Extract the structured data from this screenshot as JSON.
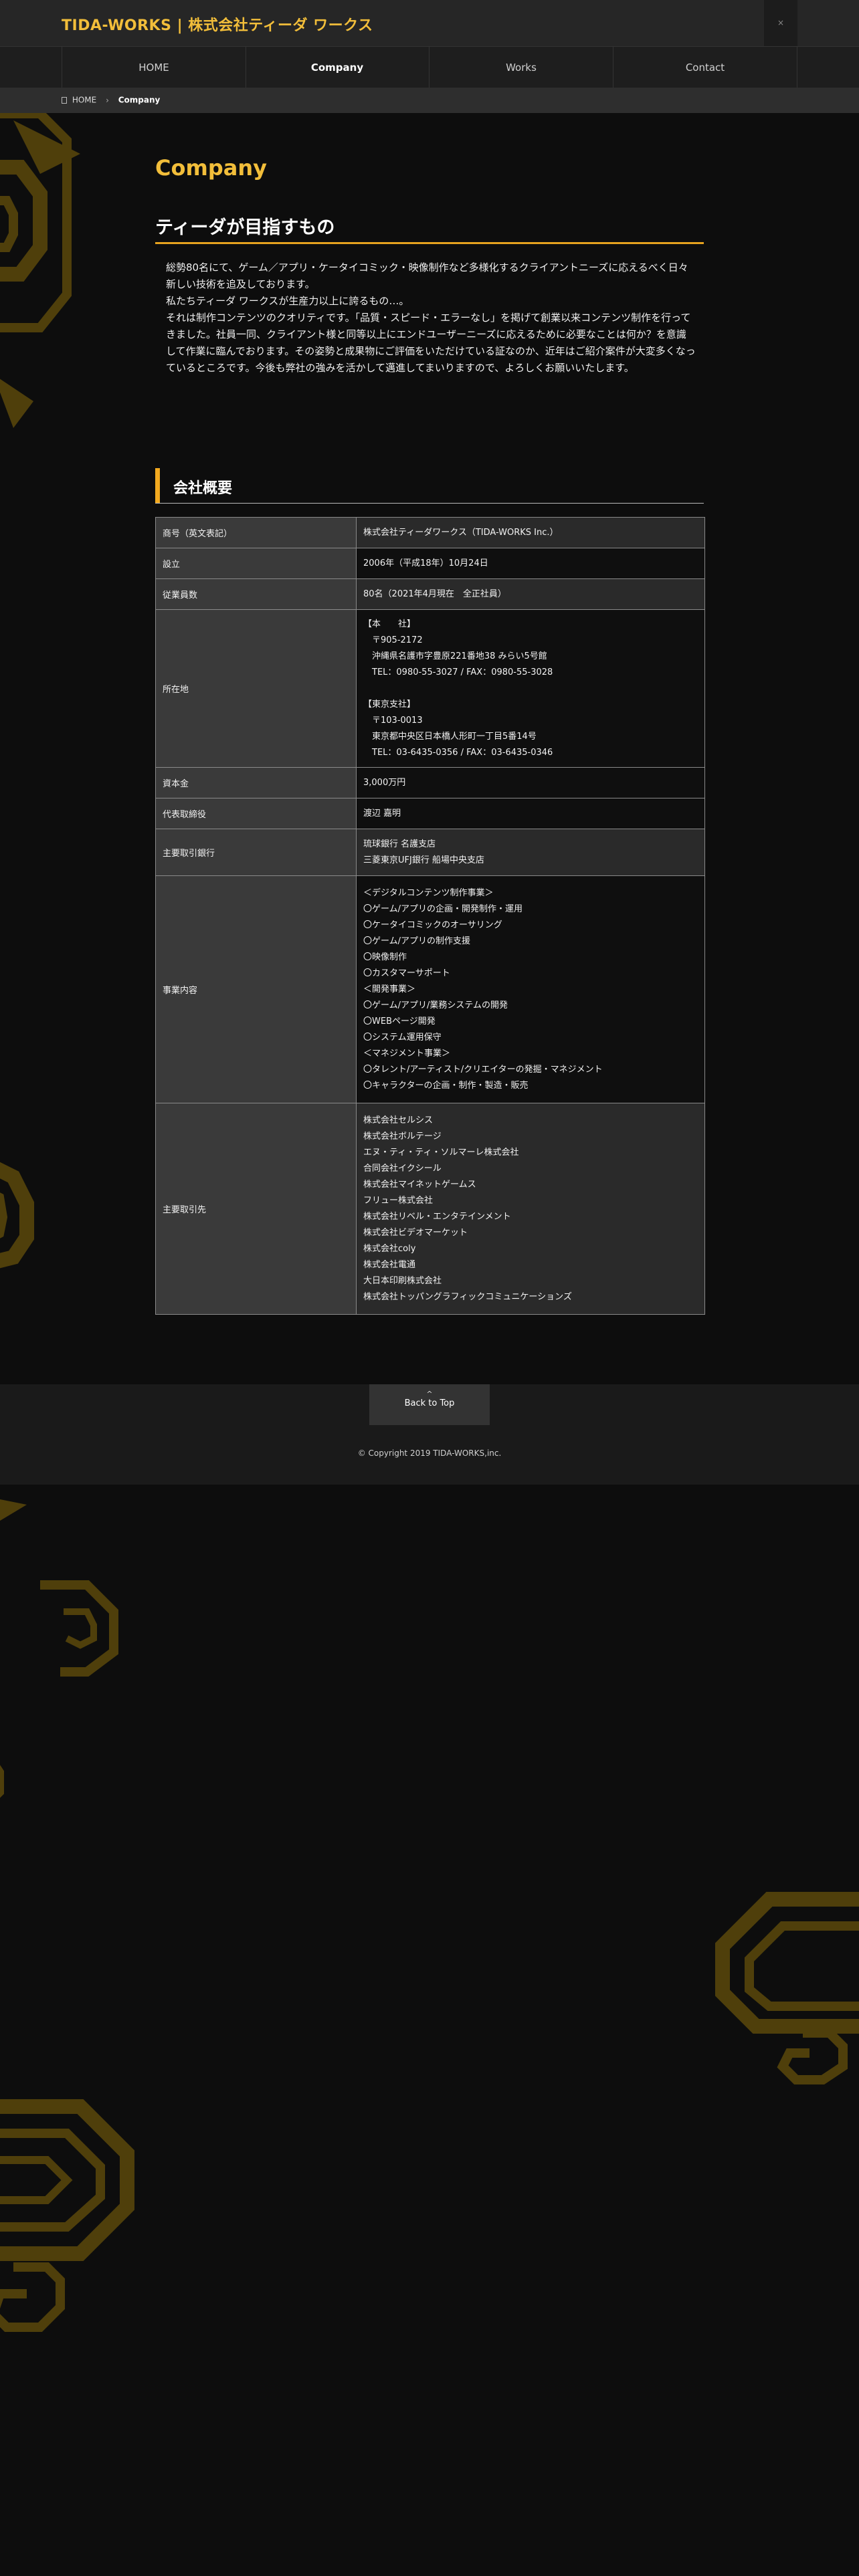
{
  "header": {
    "site_title": "TIDA-WORKS | 株式会社ティーダ ワークス",
    "menu_icon": "×"
  },
  "nav": {
    "items": [
      {
        "label": "HOME"
      },
      {
        "label": "Company"
      },
      {
        "label": "Works"
      },
      {
        "label": "Contact"
      }
    ],
    "active": "Company"
  },
  "breadcrumb": {
    "home": "HOME",
    "separator": "›",
    "current": "Company"
  },
  "page": {
    "title": "Company"
  },
  "section1": {
    "title": "ティーダが目指すもの",
    "paragraphs": [
      "総勢80名にて、ゲーム／アプリ・ケータイコミック・映像制作など多様化するクライアントニーズに応えるべく日々新しい技術を追及しております。",
      "私たちティーダ ワークスが生産力以上に誇るもの…。",
      "それは制作コンテンツのクオリティです。「品質・スピード・エラーなし」を掲げて創業以来コンテンツ制作を行ってきました。社員一同、クライアント様と同等以上にエンドユーザーニーズに応えるために必要なことは何か？を意識して作業に臨んでおります。その姿勢と成果物にご評価をいただけている証なのか、近年はご紹介案件が大変多くなっているところです。今後も弊社の強みを活かして邁進してまいりますので、よろしくお願いいたします。"
    ]
  },
  "section2": {
    "title": "会社概要",
    "rows": [
      {
        "label": "商号（英文表記）",
        "lines": [
          "株式会社ティーダワークス（TIDA-WORKS Inc.）"
        ]
      },
      {
        "label": "設立",
        "lines": [
          "2006年（平成18年）10月24日"
        ]
      },
      {
        "label": "従業員数",
        "lines": [
          "80名（2021年4月現在　全正社員）"
        ]
      },
      {
        "label": "所在地",
        "lines": [
          "【本　　社】",
          "　〒905-2172",
          "　沖縄県名護市字豊原221番地38 みらい5号館",
          "　TEL：0980-55-3027 / FAX：0980-55-3028",
          "",
          "【東京支社】",
          "　〒103-0013",
          "　東京都中央区日本橋人形町一丁目5番14号",
          "　TEL：03-6435-0356 / FAX：03-6435-0346"
        ]
      },
      {
        "label": "資本金",
        "lines": [
          "3,000万円"
        ]
      },
      {
        "label": "代表取締役",
        "lines": [
          "渡辺 嘉明"
        ]
      },
      {
        "label": "主要取引銀行",
        "lines": [
          "琉球銀行 名護支店",
          "三菱東京UFJ銀行 船場中央支店"
        ]
      },
      {
        "label": "事業内容",
        "lines": [
          "＜デジタルコンテンツ制作事業＞",
          "〇ゲーム/アプリの企画・開発制作・運用",
          "〇ケータイコミックのオーサリング",
          "〇ゲーム/アプリの制作支援",
          "〇映像制作",
          "〇カスタマーサポート",
          "＜開発事業＞",
          "〇ゲーム/アプリ/業務システムの開発",
          "〇WEBページ開発",
          "〇システム運用保守",
          "＜マネジメント事業＞",
          "〇タレント/アーティスト/クリエイターの発掘・マネジメント",
          "〇キャラクターの企画・制作・製造・販売"
        ]
      },
      {
        "label": "主要取引先",
        "lines": [
          "株式会社セルシス",
          "株式会社ボルテージ",
          "エヌ・ティ・ティ・ソルマーレ株式会社",
          "合同会社イクシール",
          "株式会社マイネットゲームス",
          "フリュー株式会社",
          "株式会社リベル・エンタテインメント",
          "株式会社ビデオマーケット",
          "株式会社coly",
          "株式会社電通",
          "大日本印刷株式会社",
          "株式会社トッパングラフィックコミュニケーションズ"
        ]
      }
    ]
  },
  "footer": {
    "back_to_top_icon": "^",
    "back_to_top": "Back to Top",
    "copyright": "© Copyright 2019 TIDA-WORKS,inc."
  },
  "icons": {
    "home": "home-icon",
    "chevron": "chevron-right-icon",
    "up": "chevron-up-icon"
  },
  "colors": {
    "accent": "#f2be3a",
    "section_bar": "#f2a91f",
    "background": "#0d0d0d",
    "deco": "#5e4a0c"
  }
}
